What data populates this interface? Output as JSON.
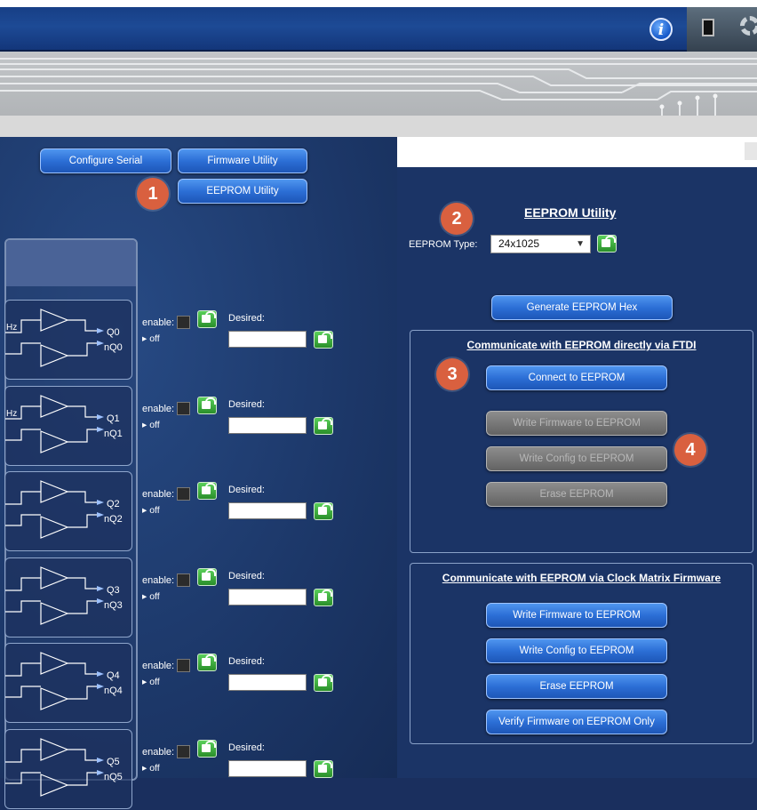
{
  "header": {
    "info_icon": "info-icon",
    "chip_icon": "chip-icon",
    "settings_icon": "gear-icon"
  },
  "toolbar": {
    "configure_serial": "Configure Serial",
    "firmware_utility": "Firmware Utility",
    "eeprom_utility": "EEPROM Utility"
  },
  "markers": {
    "m1": "1",
    "m2": "2",
    "m3": "3",
    "m4": "4"
  },
  "outputs": {
    "enable_label": "enable:",
    "off_label": "off",
    "desired_label": "Desired:",
    "hz_label": "Hz",
    "rows": [
      {
        "q": "Q0",
        "nq": "nQ0",
        "show_hz": true
      },
      {
        "q": "Q1",
        "nq": "nQ1",
        "show_hz": true
      },
      {
        "q": "Q2",
        "nq": "nQ2",
        "show_hz": false
      },
      {
        "q": "Q3",
        "nq": "nQ3",
        "show_hz": false
      },
      {
        "q": "Q4",
        "nq": "nQ4",
        "show_hz": false
      },
      {
        "q": "Q5",
        "nq": "nQ5",
        "show_hz": false
      }
    ]
  },
  "eeprom": {
    "title": "EEPROM Utility",
    "type_label": "EEPROM Type:",
    "type_value": "24x1025",
    "generate_hex": "Generate EEPROM Hex",
    "ftdi": {
      "title": "Communicate with EEPROM directly via FTDI",
      "connect": "Connect to EEPROM",
      "write_firmware": "Write Firmware to EEPROM",
      "write_config": "Write Config to EEPROM",
      "erase": "Erase EEPROM"
    },
    "firmware": {
      "title": "Communicate with EEPROM via Clock Matrix Firmware",
      "write_firmware": "Write Firmware to EEPROM",
      "write_config": "Write Config to EEPROM",
      "erase": "Erase EEPROM",
      "verify": "Verify Firmware on EEPROM Only"
    }
  }
}
